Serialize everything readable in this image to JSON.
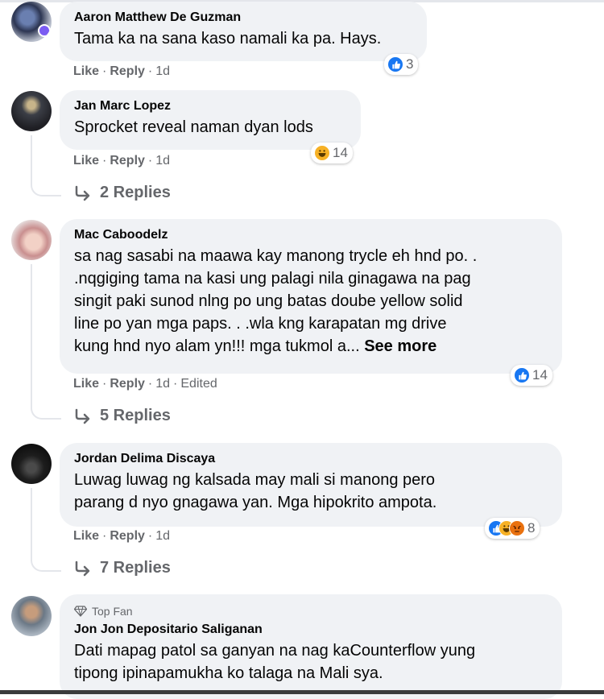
{
  "comments": [
    {
      "author": "Aaron Matthew De Guzman",
      "text": "Tama ka na sana kaso namali ka pa. Hays.",
      "reaction_count": "3",
      "like": "Like",
      "reply": "Reply",
      "time": "1d"
    },
    {
      "author": "Jan Marc Lopez",
      "text": "Sprocket reveal naman dyan lods",
      "reaction_count": "14",
      "like": "Like",
      "reply": "Reply",
      "time": "1d",
      "replies": "2 Replies"
    },
    {
      "author": "Mac Caboodelz",
      "text_lines": [
        "sa nag sasabi na maawa kay manong trycle eh hnd po. .",
        ".nqgiging tama na kasi ung palagi nila ginagawa na pag",
        "singit paki sunod nlng po ung batas doube yellow solid",
        "line po yan mga paps. . .wla kng karapatan mg drive",
        "kung hnd nyo alam yn!!! mga tukmol a..."
      ],
      "see_more": "See more",
      "reaction_count": "14",
      "like": "Like",
      "reply": "Reply",
      "time": "1d",
      "edited": "Edited",
      "replies": "5 Replies"
    },
    {
      "author": "Jordan Delima Discaya",
      "text_lines": [
        "Luwag luwag ng kalsada may mali si manong pero",
        "parang d nyo gnagawa yan. Mga hipokrito ampota."
      ],
      "reaction_count": "8",
      "like": "Like",
      "reply": "Reply",
      "time": "1d",
      "replies": "7 Replies"
    },
    {
      "top_fan": "Top Fan",
      "author": "Jon Jon Depositario Saliganan",
      "text_lines": [
        "Dati mapag patol sa ganyan na nag kaCounterflow yung",
        "tipong ipinapamukha ko talaga na Mali sya."
      ]
    }
  ],
  "separator": "·",
  "colors": {
    "bubble": "#f0f2f5",
    "secondary_text": "#65676b",
    "like_blue": "#1877f2",
    "haha_yellow": "#f7b125",
    "angry_orange": "#e9710f"
  },
  "icons": [
    "like-reaction-icon",
    "haha-reaction-icon",
    "angry-reaction-icon",
    "reply-arrow-icon",
    "top-fan-diamond-icon"
  ]
}
